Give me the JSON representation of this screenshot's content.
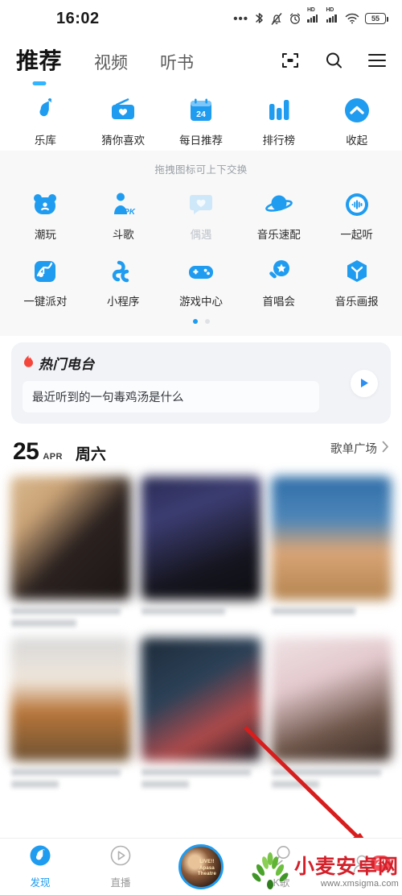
{
  "theme": {
    "accent": "#1f9cf0",
    "accent_light": "#33b4ff",
    "badge_red": "#f4525c",
    "watermark_red": "#d3202a"
  },
  "statusbar": {
    "time": "16:02",
    "battery_level": "55",
    "icons": [
      "more-dots-icon",
      "bluetooth-icon",
      "bell-muted-icon",
      "alarm-clock-icon",
      "hd-signal-icon",
      "hd-signal-icon",
      "wifi-icon",
      "battery-icon"
    ],
    "hd_label": "HD"
  },
  "topnav": {
    "tabs": [
      {
        "label": "推荐",
        "active": true
      },
      {
        "label": "视频",
        "active": false
      },
      {
        "label": "听书",
        "active": false
      }
    ],
    "actions": [
      "scan-icon",
      "search-icon",
      "menu-icon"
    ]
  },
  "entries": {
    "row1": [
      {
        "label": "乐库",
        "icon": "music-note-icon"
      },
      {
        "label": "猜你喜欢",
        "icon": "radio-heart-icon"
      },
      {
        "label": "每日推荐",
        "icon": "calendar-icon",
        "calendar_day": "24"
      },
      {
        "label": "排行榜",
        "icon": "bar-chart-icon"
      },
      {
        "label": "收起",
        "icon": "chevron-up-circle-icon"
      }
    ],
    "hint": "拖拽图标可上下交换",
    "row2": [
      {
        "label": "潮玩",
        "icon": "bear-icon"
      },
      {
        "label": "斗歌",
        "icon": "pk-person-icon",
        "badge_text": "PK"
      },
      {
        "label": "偶遇",
        "icon": "chat-heart-icon",
        "dimmed": true
      },
      {
        "label": "音乐速配",
        "icon": "planet-icon"
      },
      {
        "label": "一起听",
        "icon": "sound-wave-circle-icon"
      }
    ],
    "row3": [
      {
        "label": "一键派对",
        "icon": "party-card-icon"
      },
      {
        "label": "小程序",
        "icon": "mini-program-icon"
      },
      {
        "label": "游戏中心",
        "icon": "gamepad-icon"
      },
      {
        "label": "首唱会",
        "icon": "mic-star-icon"
      },
      {
        "label": "音乐画报",
        "icon": "cube-icon"
      }
    ],
    "pager": {
      "count": 2,
      "active_index": 0
    }
  },
  "radio_card": {
    "fire_icon": "fire-icon",
    "title": "热门电台",
    "question": "最近听到的一句毒鸡汤是什么",
    "play_icon": "play-icon"
  },
  "date_row": {
    "day_number": "25",
    "month": "APR",
    "weekday": "周六",
    "link_label": "歌单广场",
    "link_icon": "chevron-right-icon"
  },
  "cards": {
    "row1": [
      {
        "img_css": "linear-gradient(135deg,#d9b98f 0%,#caa377 25%,#2b2220 55%,#1b1513 100%)",
        "lines": [
          "w90",
          "w55"
        ]
      },
      {
        "img_css": "linear-gradient(160deg,#2a2b55 0%,#3c3d72 30%,#15151f 70%,#0d0d12 100%)",
        "lines": [
          "w70"
        ]
      },
      {
        "img_css": "linear-gradient(180deg,#2f6ea8 0%,#4e86b8 35%,#d9a577 60%,#b4844f 100%)",
        "lines": [
          "w70"
        ]
      }
    ],
    "row2": [
      {
        "img_css": "linear-gradient(180deg,#d8d8d8 0%,#efe6db 35%,#b8763a 60%,#6d5132 100%)",
        "lines": [
          "w90",
          "w40"
        ]
      },
      {
        "img_css": "linear-gradient(150deg,#1d2b3a 0%,#2c4157 40%,#b04a4a 70%,#121a24 100%)",
        "lines": [
          "w90",
          "w40"
        ]
      },
      {
        "img_css": "linear-gradient(160deg,#efe2e4 0%,#e3c9cd 35%,#6c5448 70%,#3a2c26 100%)",
        "lines": [
          "w90",
          "w40"
        ]
      }
    ]
  },
  "bottomnav": {
    "items": [
      {
        "label": "发现",
        "icon": "discover-note-icon",
        "active": true
      },
      {
        "label": "直播",
        "icon": "live-play-icon",
        "active": false
      },
      {
        "label": "",
        "icon": "user-avatar",
        "active": false,
        "avatar_text": "LIVE!!\nApasa\nTheatre"
      },
      {
        "label": "K歌",
        "icon": "karaoke-mic-icon",
        "active": false
      },
      {
        "label": "",
        "icon": "my-profile-icon",
        "active": false,
        "badge": "20"
      }
    ]
  },
  "watermark": {
    "cn": "小麦安卓网",
    "url": "www.xmsigma.com",
    "logo": "wheat-logo-icon"
  },
  "annotation": {
    "arrow": "red-arrow-pointer"
  }
}
